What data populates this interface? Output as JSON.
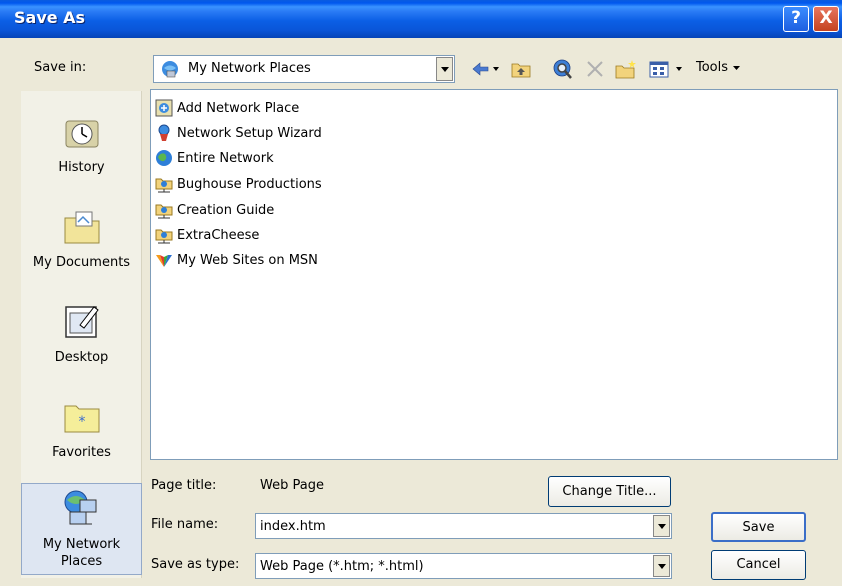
{
  "window": {
    "title": "Save As",
    "help_glyph": "?",
    "close_glyph": "X"
  },
  "save_in": {
    "label": "Save in:",
    "value": "My Network Places"
  },
  "toolbar": {
    "tools_label": "Tools",
    "icons": [
      "back-icon",
      "up-folder-icon",
      "search-web-icon",
      "delete-icon",
      "new-folder-icon",
      "views-icon"
    ]
  },
  "places": [
    {
      "label": "History",
      "icon": "history-icon"
    },
    {
      "label": "My Documents",
      "icon": "my-documents-icon"
    },
    {
      "label": "Desktop",
      "icon": "desktop-icon"
    },
    {
      "label": "Favorites",
      "icon": "favorites-icon"
    },
    {
      "label": "My Network Places",
      "label_line1": "My Network",
      "label_line2": "Places",
      "icon": "network-places-icon",
      "active": true
    }
  ],
  "files": [
    {
      "name": "Add Network Place",
      "icon": "add-network-place-icon"
    },
    {
      "name": "Network Setup Wizard",
      "icon": "network-wizard-icon"
    },
    {
      "name": "Entire Network",
      "icon": "entire-network-icon"
    },
    {
      "name": "Bughouse Productions",
      "icon": "network-folder-icon"
    },
    {
      "name": "Creation Guide",
      "icon": "network-folder-icon"
    },
    {
      "name": "ExtraCheese",
      "icon": "network-folder-icon"
    },
    {
      "name": "My Web Sites on MSN",
      "icon": "msn-icon"
    }
  ],
  "form": {
    "page_title_label": "Page title:",
    "page_title_value": "Web Page",
    "change_title_button": "Change Title...",
    "file_name_label": "File name:",
    "file_name_value": "index.htm",
    "save_as_type_label": "Save as type:",
    "save_as_type_value": "Web Page (*.htm; *.html)",
    "save_button": "Save",
    "cancel_button": "Cancel"
  },
  "colors": {
    "titlebar": "#0A55D8",
    "dialog_bg": "#ECE9D8",
    "places_bg": "#F2F1E7",
    "active_place_bg": "#DEE6F2"
  }
}
